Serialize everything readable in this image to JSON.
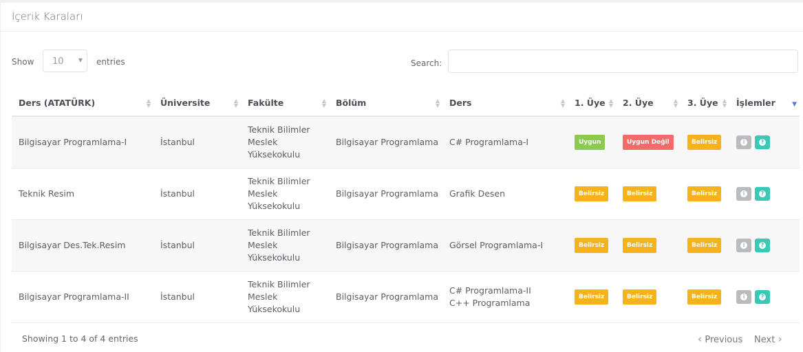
{
  "panel": {
    "title": "İçerik Karaları"
  },
  "controls": {
    "show_label": "Show",
    "length_value": "10",
    "entries_label": "entries",
    "search_label": "Search:",
    "search_value": ""
  },
  "table": {
    "columns": [
      "Ders (ATATÜRK)",
      "Üniversite",
      "Fakülte",
      "Bölüm",
      "Ders",
      "1. Üye",
      "2. Üye",
      "3. Üye",
      "İşlemler"
    ],
    "rows": [
      {
        "ders_ataturk": "Bilgisayar Programlama-I",
        "universite": "İstanbul",
        "fakulte": [
          "Teknik Bilimler",
          "Meslek",
          "Yüksekokulu"
        ],
        "bolum": "Bilgisayar Programlama",
        "ders": [
          "C# Programlama-I"
        ],
        "uye1": "Uygun",
        "uye2": "Uygun Değil",
        "uye3": "Belirsiz"
      },
      {
        "ders_ataturk": "Teknik Resim",
        "universite": "İstanbul",
        "fakulte": [
          "Teknik Bilimler",
          "Meslek",
          "Yüksekokulu"
        ],
        "bolum": "Bilgisayar Programlama",
        "ders": [
          "Grafik Desen"
        ],
        "uye1": "Belirsiz",
        "uye2": "Belirsiz",
        "uye3": "Belirsiz"
      },
      {
        "ders_ataturk": "Bilgisayar Des.Tek.Resim",
        "universite": "İstanbul",
        "fakulte": [
          "Teknik Bilimler",
          "Meslek",
          "Yüksekokulu"
        ],
        "bolum": "Bilgisayar Programlama",
        "ders": [
          "Görsel Programlama-I"
        ],
        "uye1": "Belirsiz",
        "uye2": "Belirsiz",
        "uye3": "Belirsiz"
      },
      {
        "ders_ataturk": "Bilgisayar Programlama-II",
        "universite": "İstanbul",
        "fakulte": [
          "Teknik Bilimler",
          "Meslek",
          "Yüksekokulu"
        ],
        "bolum": "Bilgisayar Programlama",
        "ders": [
          "C# Programlama-II",
          "C++ Programlama"
        ],
        "uye1": "Belirsiz",
        "uye2": "Belirsiz",
        "uye3": "Belirsiz"
      }
    ],
    "status_colors": {
      "Uygun": "#8cc94f",
      "Uygun Değil": "#f36a6a",
      "Belirsiz": "#f5b21d"
    },
    "action_icons": [
      "info-icon",
      "question-icon"
    ]
  },
  "footer": {
    "info": "Showing 1 to 4 of 4 entries",
    "previous_label": "Previous",
    "next_label": "Next"
  }
}
